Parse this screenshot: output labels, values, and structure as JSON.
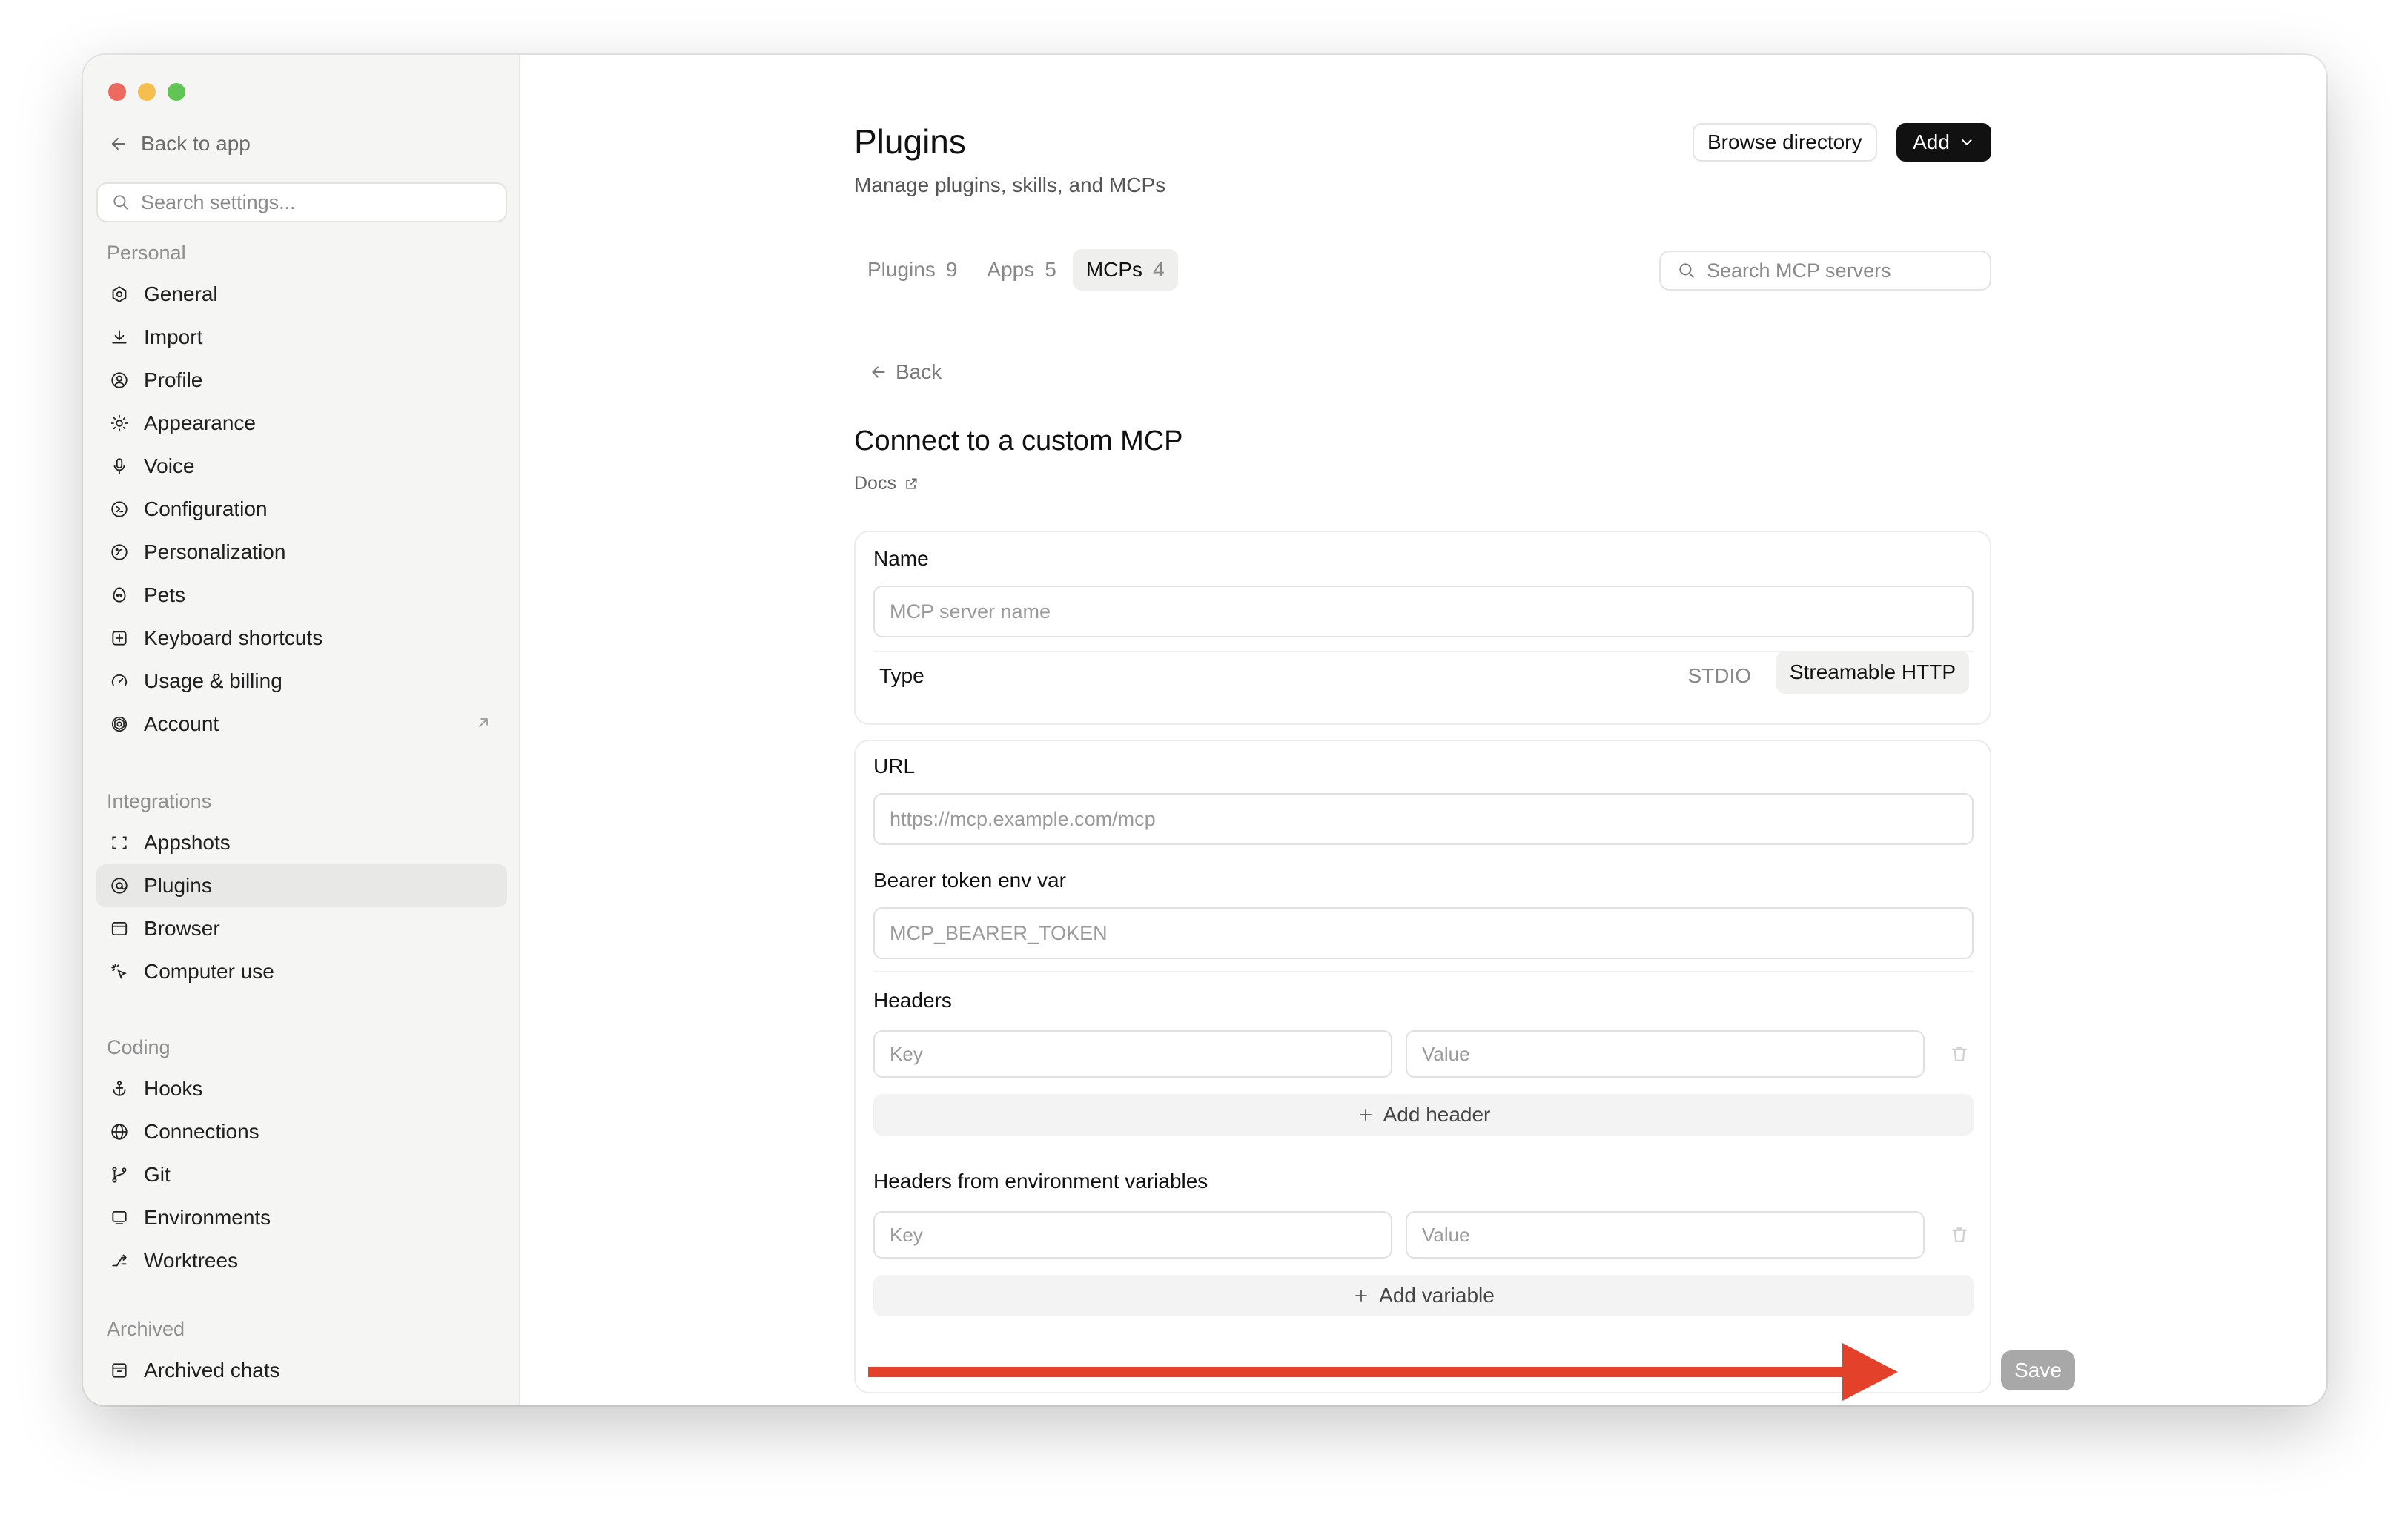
{
  "colors": {
    "accent": "#111111",
    "annotation_arrow": "#e4412b",
    "sidebar_bg": "#f5f5f4"
  },
  "sidebar": {
    "back_label": "Back to app",
    "search_placeholder": "Search settings...",
    "sections": {
      "personal": "Personal",
      "integrations": "Integrations",
      "coding": "Coding",
      "archived": "Archived"
    },
    "personal_items": [
      {
        "label": "General",
        "icon": "gear-icon"
      },
      {
        "label": "Import",
        "icon": "download-icon"
      },
      {
        "label": "Profile",
        "icon": "profile-icon"
      },
      {
        "label": "Appearance",
        "icon": "sun-icon"
      },
      {
        "label": "Voice",
        "icon": "microphone-icon"
      },
      {
        "label": "Configuration",
        "icon": "config-icon"
      },
      {
        "label": "Personalization",
        "icon": "personalization-icon"
      },
      {
        "label": "Pets",
        "icon": "egg-icon"
      },
      {
        "label": "Keyboard shortcuts",
        "icon": "keyboard-icon"
      },
      {
        "label": "Usage & billing",
        "icon": "gauge-icon"
      },
      {
        "label": "Account",
        "icon": "openai-icon"
      }
    ],
    "integration_items": [
      {
        "label": "Appshots",
        "icon": "screenshot-icon"
      },
      {
        "label": "Plugins",
        "icon": "plugin-icon",
        "active": true
      },
      {
        "label": "Browser",
        "icon": "browser-icon"
      },
      {
        "label": "Computer use",
        "icon": "cursor-icon"
      }
    ],
    "coding_items": [
      {
        "label": "Hooks",
        "icon": "anchor-icon"
      },
      {
        "label": "Connections",
        "icon": "globe-icon"
      },
      {
        "label": "Git",
        "icon": "git-branch-icon"
      },
      {
        "label": "Environments",
        "icon": "laptop-icon"
      },
      {
        "label": "Worktrees",
        "icon": "worktree-icon"
      }
    ],
    "archived_items": [
      {
        "label": "Archived chats",
        "icon": "archive-icon"
      }
    ]
  },
  "header": {
    "title": "Plugins",
    "subtitle": "Manage plugins, skills, and MCPs",
    "browse_label": "Browse directory",
    "add_label": "Add"
  },
  "tabs": [
    {
      "label": "Plugins",
      "count": "9"
    },
    {
      "label": "Apps",
      "count": "5"
    },
    {
      "label": "MCPs",
      "count": "4",
      "active": true
    }
  ],
  "search": {
    "placeholder": "Search MCP servers"
  },
  "form": {
    "back_label": "Back",
    "title": "Connect to a custom MCP",
    "docs_label": "Docs",
    "name_label": "Name",
    "name_placeholder": "MCP server name",
    "type_label": "Type",
    "type_options": [
      "STDIO",
      "Streamable HTTP"
    ],
    "type_selected": "Streamable HTTP",
    "url_label": "URL",
    "url_placeholder": "https://mcp.example.com/mcp",
    "bearer_label": "Bearer token env var",
    "bearer_placeholder": "MCP_BEARER_TOKEN",
    "headers_label": "Headers",
    "key_placeholder": "Key",
    "value_placeholder": "Value",
    "add_header_label": "Add header",
    "env_headers_label": "Headers from environment variables",
    "add_variable_label": "Add variable",
    "save_label": "Save"
  }
}
